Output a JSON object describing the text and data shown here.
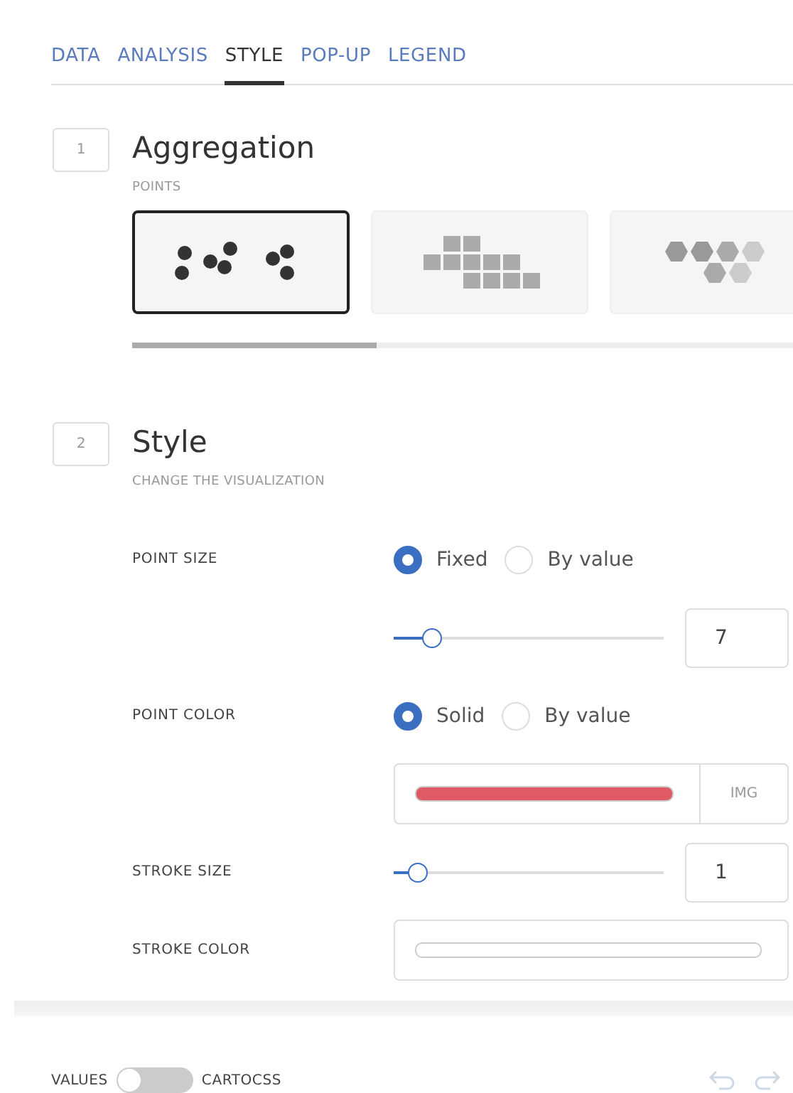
{
  "tabs": [
    {
      "label": "DATA",
      "selected": false
    },
    {
      "label": "ANALYSIS",
      "selected": false
    },
    {
      "label": "STYLE",
      "selected": true
    },
    {
      "label": "POP-UP",
      "selected": false
    },
    {
      "label": "LEGEND",
      "selected": false
    }
  ],
  "aggregation": {
    "number": "1",
    "title": "Aggregation",
    "subtitle": "POINTS",
    "options": [
      {
        "kind": "points",
        "selected": true
      },
      {
        "kind": "squares",
        "selected": false
      },
      {
        "kind": "hexagons",
        "selected": false
      }
    ]
  },
  "style": {
    "number": "2",
    "title": "Style",
    "subtitle": "CHANGE THE VISUALIZATION",
    "rows": [
      {
        "kind": "radio",
        "label": "POINT SIZE",
        "options": [
          {
            "label": "Fixed",
            "selected": true
          },
          {
            "label": "By value",
            "selected": false
          }
        ]
      },
      {
        "kind": "slider",
        "label": "",
        "level": 0.14,
        "value": "7"
      },
      {
        "kind": "radio",
        "label": "POINT COLOR",
        "options": [
          {
            "label": "Solid",
            "selected": true
          },
          {
            "label": "By value",
            "selected": false
          }
        ]
      },
      {
        "kind": "color",
        "label": "",
        "color": "#e05a66",
        "button": "IMG"
      },
      {
        "kind": "slider",
        "label": "STROKE SIZE",
        "level": 0.09,
        "value": "1"
      },
      {
        "kind": "color",
        "label": "STROKE COLOR",
        "color": "#ffffff"
      }
    ]
  },
  "footer": {
    "left_label": "VALUES",
    "toggle_on": false,
    "right_label": "CARTOCSS"
  }
}
